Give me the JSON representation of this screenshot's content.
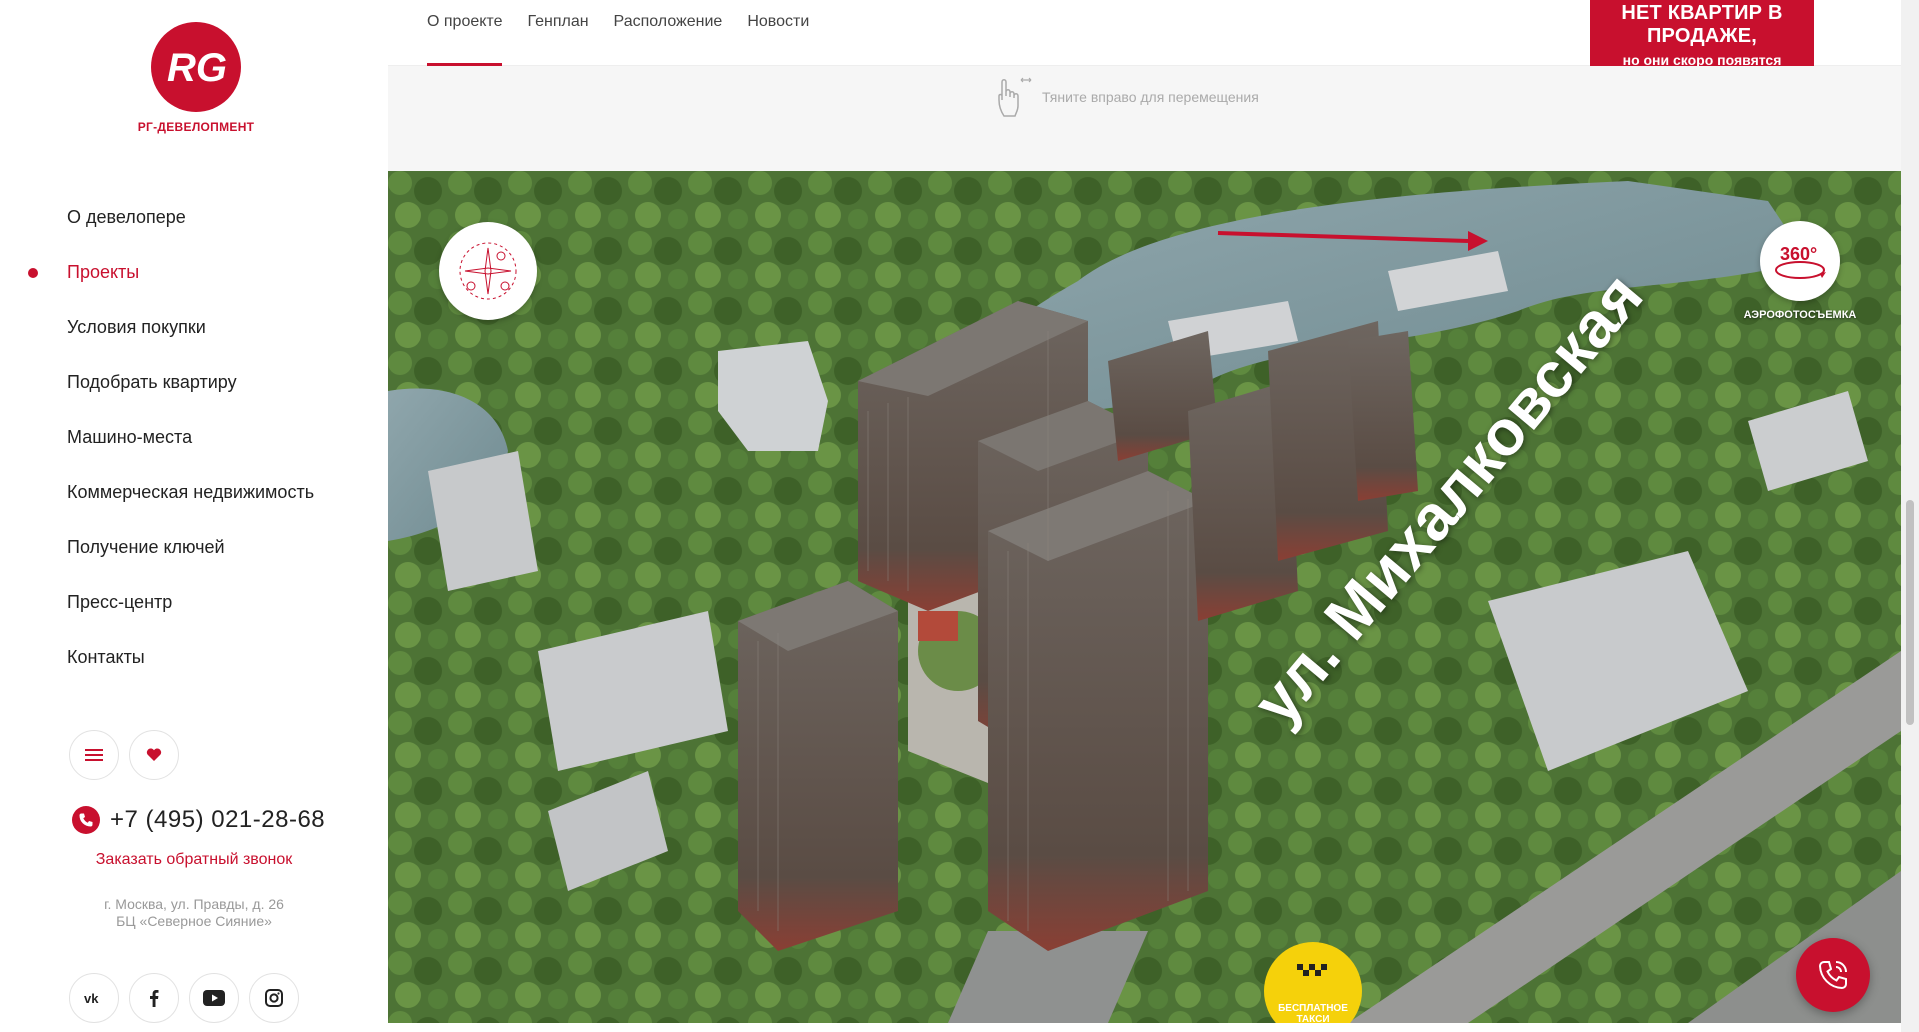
{
  "brand": {
    "logo_letters": "RG",
    "logo_text": "РГ-ДЕВЕЛОПМЕНТ",
    "accent_color": "#c8102e"
  },
  "sidebar": {
    "items": [
      {
        "label": "О девелопере",
        "active": false
      },
      {
        "label": "Проекты",
        "active": true
      },
      {
        "label": "Условия покупки",
        "active": false
      },
      {
        "label": "Подобрать квартиру",
        "active": false
      },
      {
        "label": "Машино-места",
        "active": false
      },
      {
        "label": "Коммерческая недвижимость",
        "active": false
      },
      {
        "label": "Получение ключей",
        "active": false
      },
      {
        "label": "Пресс-центр",
        "active": false
      },
      {
        "label": "Контакты",
        "active": false
      }
    ],
    "menu_icon": "menu-icon",
    "favorites_icon": "heart-icon",
    "phone": "+7 (495) 021-28-68",
    "callback_label": "Заказать обратный звонок",
    "address_line1": "г. Москва, ул. Правды, д. 26",
    "address_line2": "БЦ «Северное Сияние»",
    "socials": [
      "vk-icon",
      "facebook-icon",
      "youtube-icon",
      "instagram-icon"
    ]
  },
  "topnav": {
    "tabs": [
      {
        "label": "О проекте",
        "active": true
      },
      {
        "label": "Генплан",
        "active": false
      },
      {
        "label": "Расположение",
        "active": false
      },
      {
        "label": "Новости",
        "active": false
      }
    ],
    "sale_title": "НЕТ КВАРТИР В ПРОДАЖЕ,",
    "sale_subtitle": "но они скоро появятся"
  },
  "hint": {
    "text": "Тяните вправо для перемещения"
  },
  "aerial": {
    "street_label": "ул. Михалковская",
    "pano_label": "АЭРОФОТОСЪЕМКА",
    "pano_badge": "360°",
    "taxi_label_1": "БЕСПЛАТНОЕ",
    "taxi_label_2": "ТАКСИ"
  }
}
